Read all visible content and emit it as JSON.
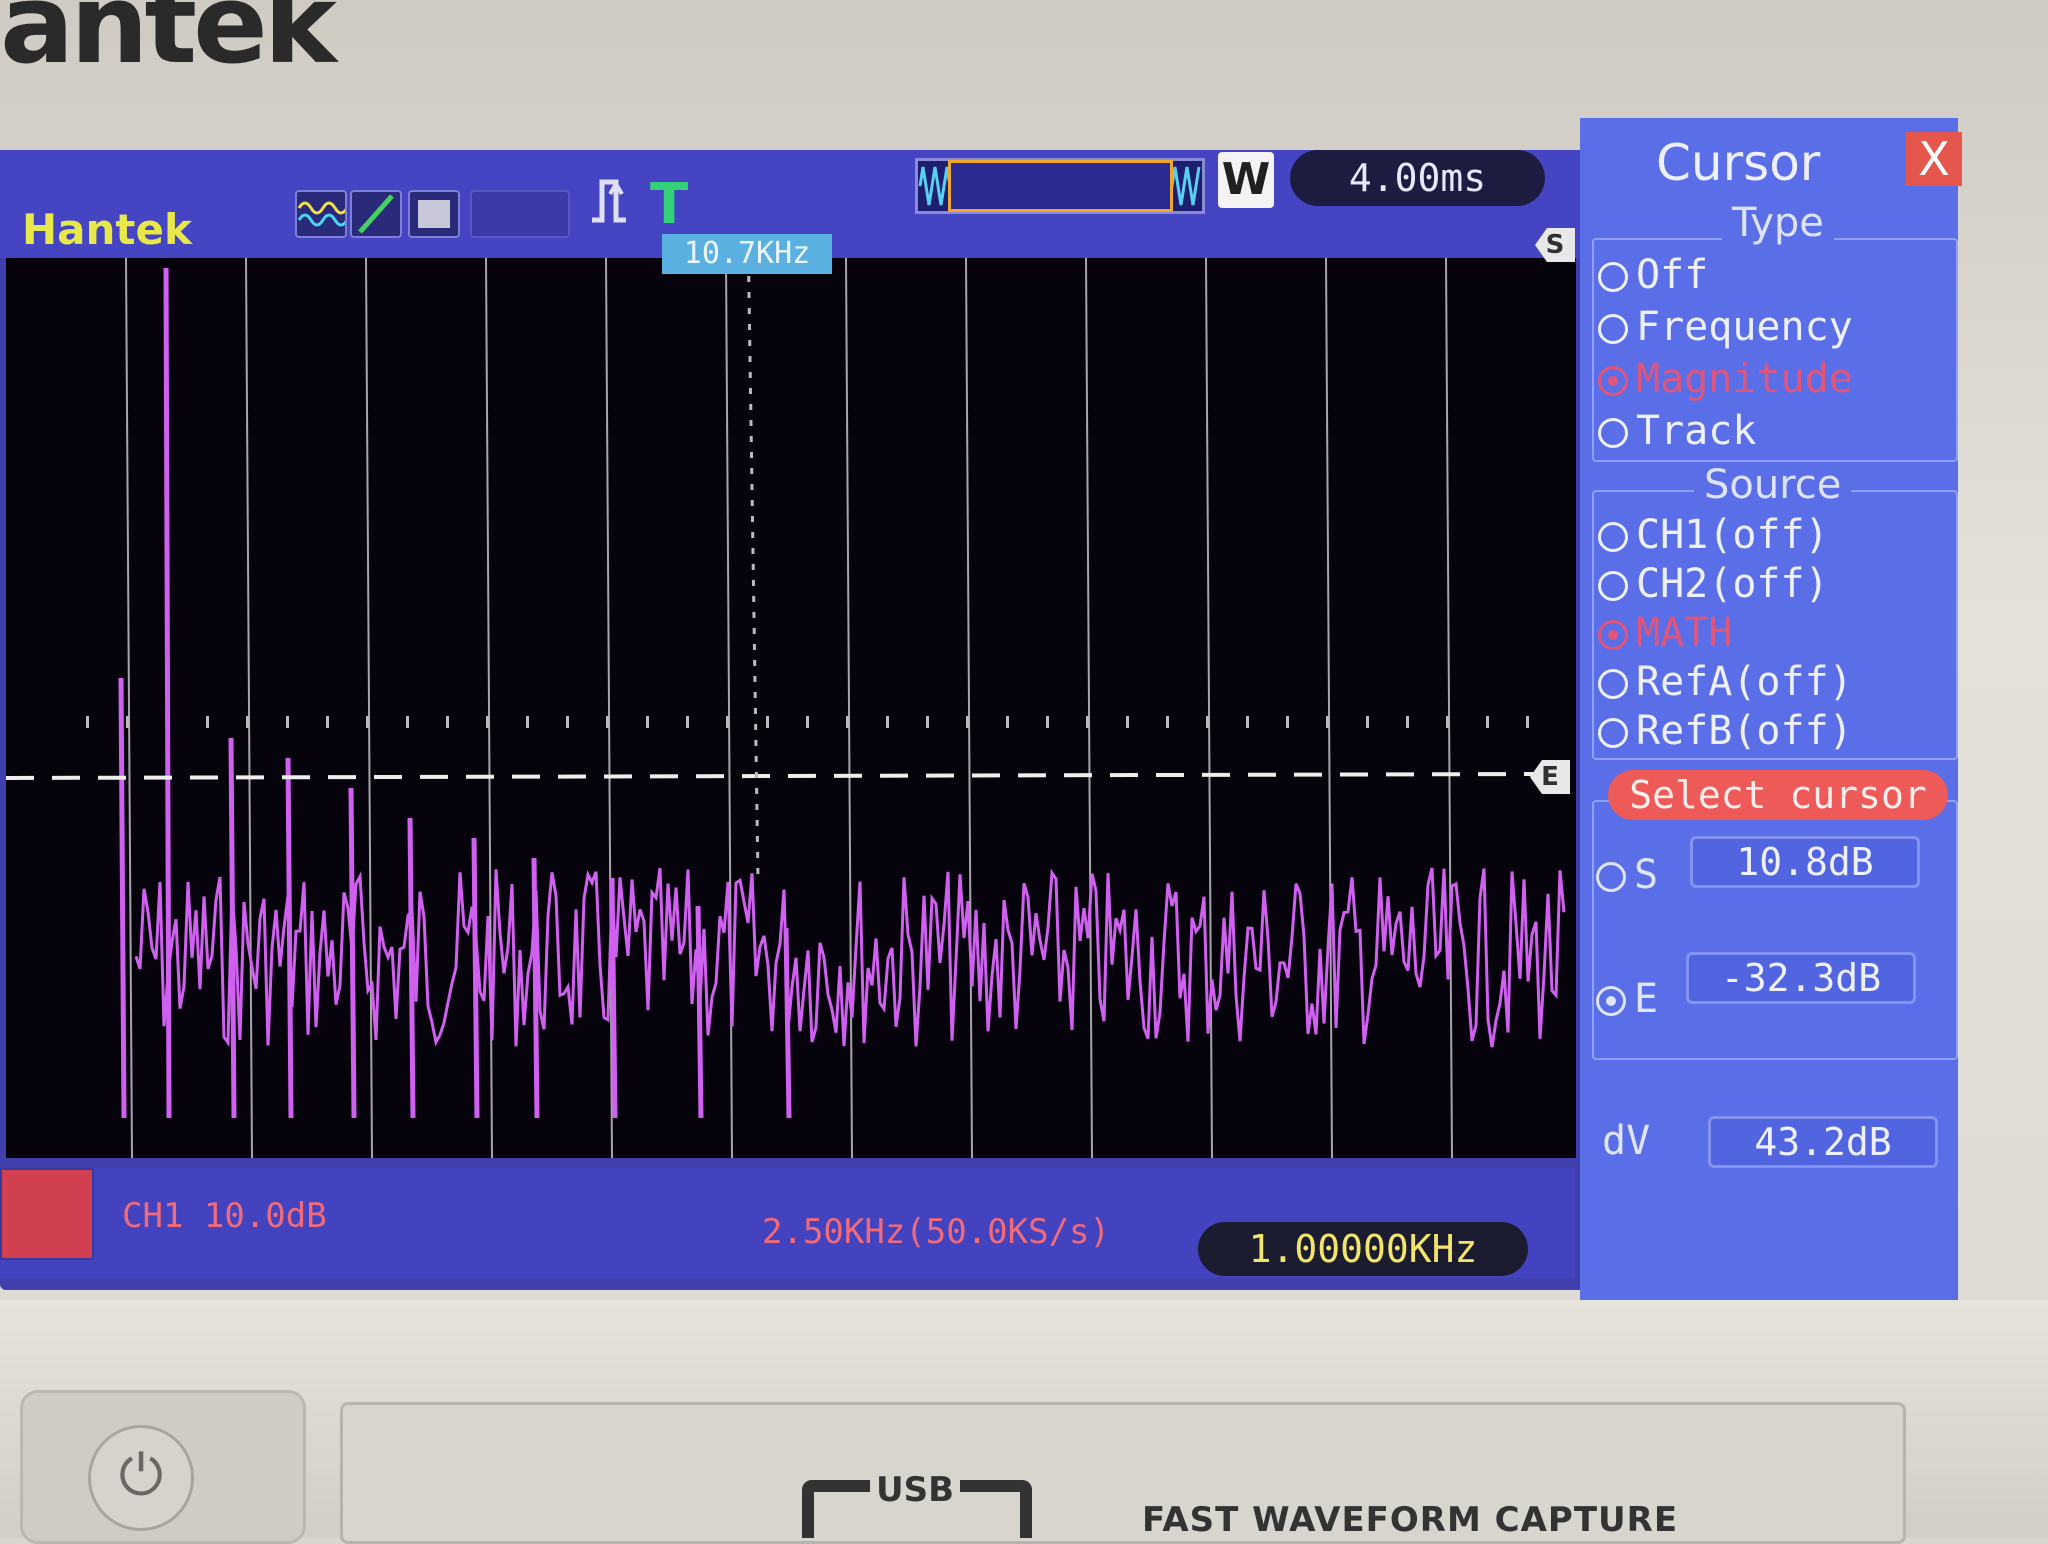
{
  "device": {
    "brand_top": "antek",
    "screen_logo": "Hantek"
  },
  "header": {
    "cursor_frequency_readout": "10.7KHz",
    "memory_badge": "W",
    "timebase": "4.00ms"
  },
  "cursor_markers": {
    "start": "S",
    "end": "E"
  },
  "footer": {
    "ch1_scale": "CH1 10.0dB",
    "math_scale": "2.50KHz(50.0KS/s)",
    "trigger_frequency": "1.00000KHz"
  },
  "menu": {
    "title": "Cursor",
    "close": "X",
    "type_heading": "Type",
    "type_options": [
      "Off",
      "Frequency",
      "Magnitude",
      "Track"
    ],
    "type_selected": "Magnitude",
    "source_heading": "Source",
    "source_options": [
      "CH1(off)",
      "CH2(off)",
      "MATH",
      "RefA(off)",
      "RefB(off)"
    ],
    "source_selected": "MATH",
    "select_cursor_label": "Select cursor",
    "s_label": "S",
    "s_value": "10.8dB",
    "e_label": "E",
    "e_value": "-32.3dB",
    "dv_label": "dV",
    "dv_value": "43.2dB",
    "selected_cursor": "E"
  },
  "panel": {
    "usb_label": "USB",
    "caption": "FAST WAVEFORM CAPTURE"
  },
  "colors": {
    "trace": "#d060f0",
    "grid": "#dcdcdc",
    "menu_bg": "#5a6ee8",
    "highlight": "#ee5a58"
  },
  "icons": [
    "math-wave-icon",
    "line-icon",
    "shape-icon",
    "trigger-edge-icon",
    "trigger-t-icon",
    "memory-waveform-icon",
    "power-icon"
  ]
}
